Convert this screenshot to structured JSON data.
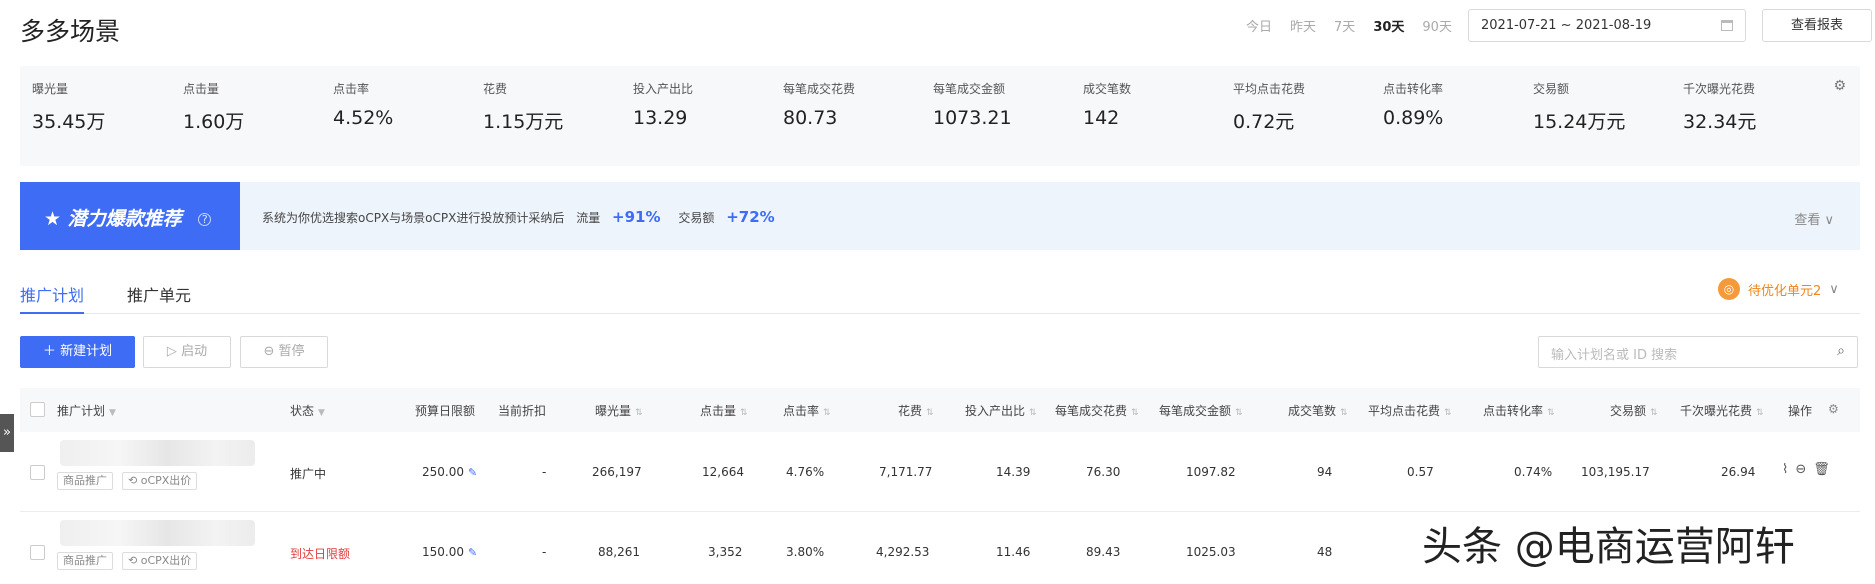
{
  "title": "多多场景",
  "date_tabs": [
    {
      "label": "今日",
      "active": false
    },
    {
      "label": "昨天",
      "active": false
    },
    {
      "label": "7天",
      "active": false
    },
    {
      "label": "30天",
      "active": true
    },
    {
      "label": "90天",
      "active": false
    }
  ],
  "date_range": "2021-07-21 ~ 2021-08-19",
  "report_button": "查看报表",
  "metrics": [
    {
      "label": "曝光量",
      "value": "35.45万"
    },
    {
      "label": "点击量",
      "value": "1.60万"
    },
    {
      "label": "点击率",
      "value": "4.52%"
    },
    {
      "label": "花费",
      "value": "1.15万元"
    },
    {
      "label": "投入产出比",
      "value": "13.29"
    },
    {
      "label": "每笔成交花费",
      "value": "80.73"
    },
    {
      "label": "每笔成交金额",
      "value": "1073.21"
    },
    {
      "label": "成交笔数",
      "value": "142"
    },
    {
      "label": "平均点击花费",
      "value": "0.72元"
    },
    {
      "label": "点击转化率",
      "value": "0.89%"
    },
    {
      "label": "交易额",
      "value": "15.24万元"
    },
    {
      "label": "千次曝光花费",
      "value": "32.34元"
    }
  ],
  "banner": {
    "title": "潜力爆款推荐",
    "text": "系统为你优选搜索oCPX与场景oCPX进行投放预计采纳后",
    "flow_label": "流量",
    "flow_value": "+91%",
    "trade_label": "交易额",
    "trade_value": "+72%",
    "view_label": "查看"
  },
  "tabs": [
    "推广计划",
    "推广单元"
  ],
  "optimize_link": "待优化单元2",
  "toolbar": {
    "new_plan": "新建计划",
    "start": "启动",
    "pause": "暂停",
    "search_placeholder": "输入计划名或 ID 搜索"
  },
  "columns": [
    "推广计划",
    "状态",
    "预算日限额",
    "当前折扣",
    "曝光量",
    "点击量",
    "点击率",
    "花费",
    "投入产出比",
    "每笔成交花费",
    "每笔成交金额",
    "成交笔数",
    "平均点击花费",
    "点击转化率",
    "交易额",
    "千次曝光花费",
    "操作"
  ],
  "rows": [
    {
      "tags": [
        "商品推广",
        "oCPX出价"
      ],
      "status": "推广中",
      "budget": "250.00",
      "discount": "-",
      "impressions": "266,197",
      "clicks": "12,664",
      "ctr": "4.76%",
      "spend": "7,171.77",
      "roi": "14.39",
      "cost_per_order": "76.30",
      "amount_per_order": "1097.82",
      "orders": "94",
      "avg_cpc": "0.57",
      "cvr": "0.74%",
      "gmv": "103,195.17",
      "cpm": "26.94"
    },
    {
      "tags": [
        "商品推广",
        "oCPX出价"
      ],
      "status": "到达日限额",
      "budget": "150.00",
      "discount": "-",
      "impressions": "88,261",
      "clicks": "3,352",
      "ctr": "3.80%",
      "spend": "4,292.53",
      "roi": "11.46",
      "cost_per_order": "89.43",
      "amount_per_order": "1025.03",
      "orders": "48",
      "avg_cpc": "",
      "cvr": "",
      "gmv": "",
      "cpm": ""
    }
  ],
  "watermark": "头条 @电商运营阿轩"
}
